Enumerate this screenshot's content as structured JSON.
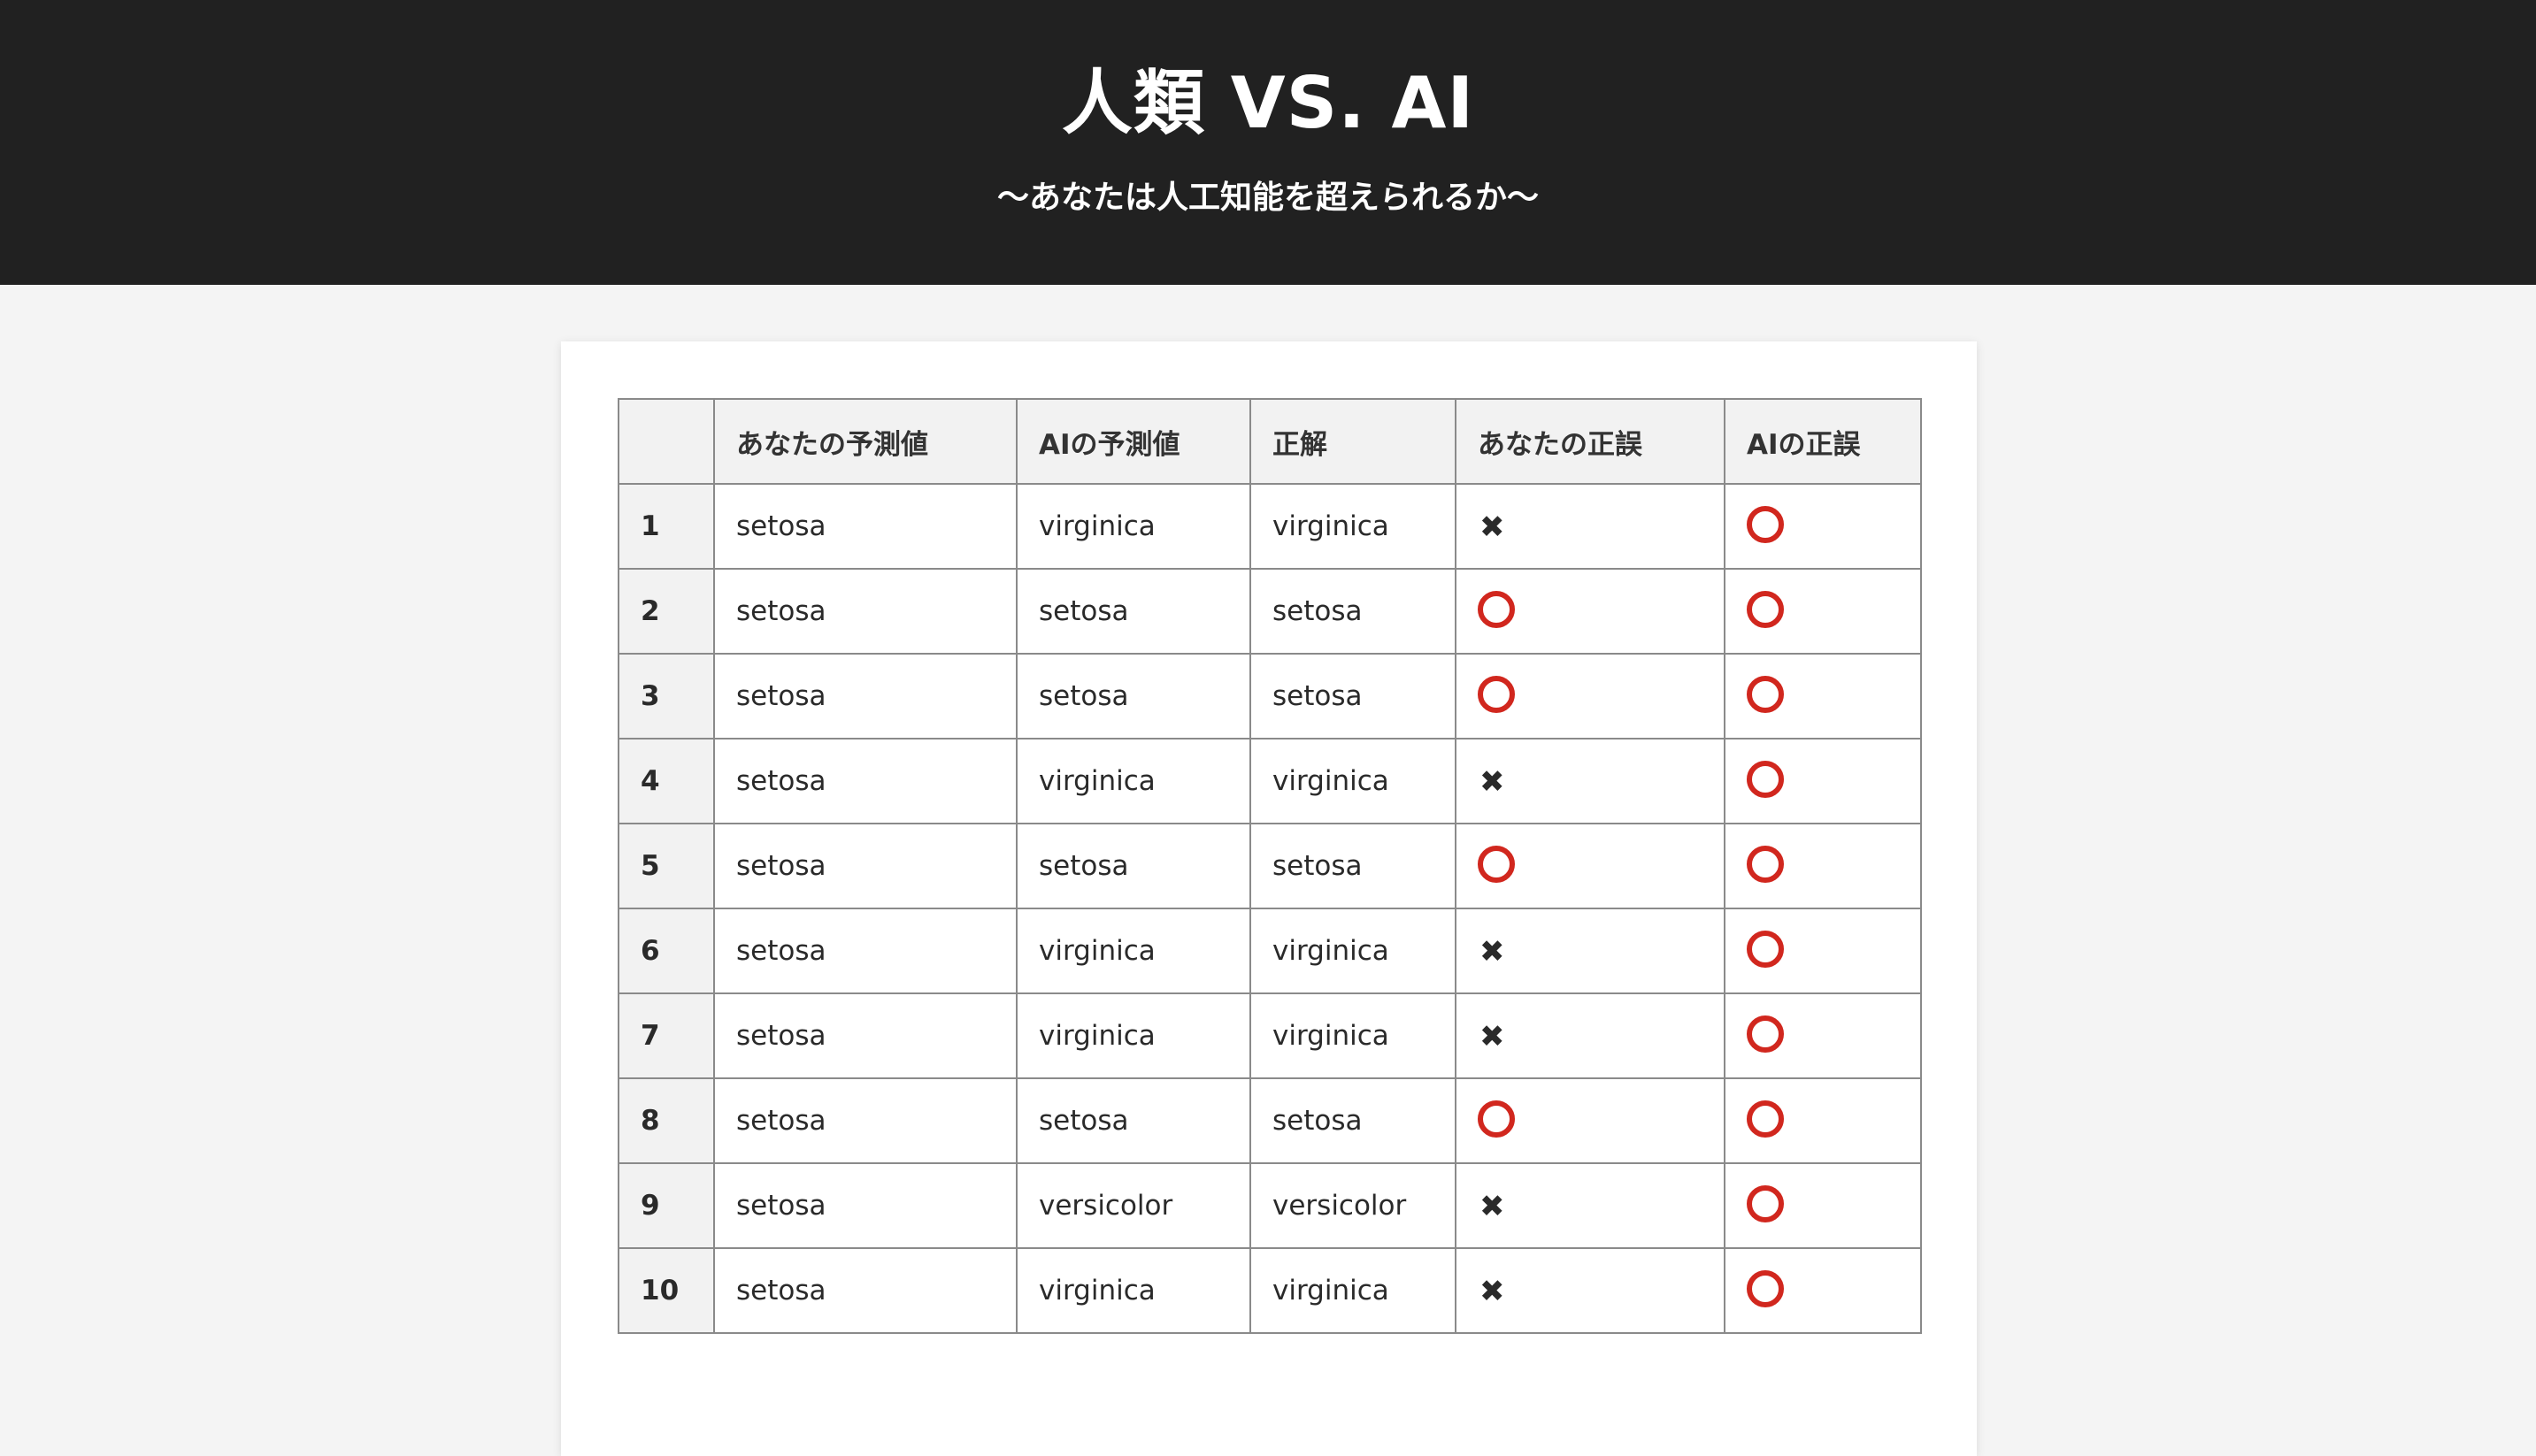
{
  "header": {
    "title": "人類 VS. AI",
    "subtitle": "〜あなたは人工知能を超えられるか〜"
  },
  "table": {
    "columns": [
      "",
      "あなたの予測値",
      "AIの予測値",
      "正解",
      "あなたの正誤",
      "AIの正誤"
    ],
    "rows": [
      {
        "no": "1",
        "you": "setosa",
        "ai": "virginica",
        "answer": "virginica",
        "you_result": "×",
        "ai_result": "○"
      },
      {
        "no": "2",
        "you": "setosa",
        "ai": "setosa",
        "answer": "setosa",
        "you_result": "○",
        "ai_result": "○"
      },
      {
        "no": "3",
        "you": "setosa",
        "ai": "setosa",
        "answer": "setosa",
        "you_result": "○",
        "ai_result": "○"
      },
      {
        "no": "4",
        "you": "setosa",
        "ai": "virginica",
        "answer": "virginica",
        "you_result": "×",
        "ai_result": "○"
      },
      {
        "no": "5",
        "you": "setosa",
        "ai": "setosa",
        "answer": "setosa",
        "you_result": "○",
        "ai_result": "○"
      },
      {
        "no": "6",
        "you": "setosa",
        "ai": "virginica",
        "answer": "virginica",
        "you_result": "×",
        "ai_result": "○"
      },
      {
        "no": "7",
        "you": "setosa",
        "ai": "virginica",
        "answer": "virginica",
        "you_result": "×",
        "ai_result": "○"
      },
      {
        "no": "8",
        "you": "setosa",
        "ai": "setosa",
        "answer": "setosa",
        "you_result": "○",
        "ai_result": "○"
      },
      {
        "no": "9",
        "you": "setosa",
        "ai": "versicolor",
        "answer": "versicolor",
        "you_result": "×",
        "ai_result": "○"
      },
      {
        "no": "10",
        "you": "setosa",
        "ai": "virginica",
        "answer": "virginica",
        "you_result": "×",
        "ai_result": "○"
      }
    ]
  },
  "icons": {
    "correct": "circle-icon",
    "incorrect": "cross-icon"
  },
  "colors": {
    "header_bg": "#212121",
    "page_bg": "#f4f4f4",
    "correct_mark": "#d1271e",
    "incorrect_mark": "#2a2a2a"
  }
}
